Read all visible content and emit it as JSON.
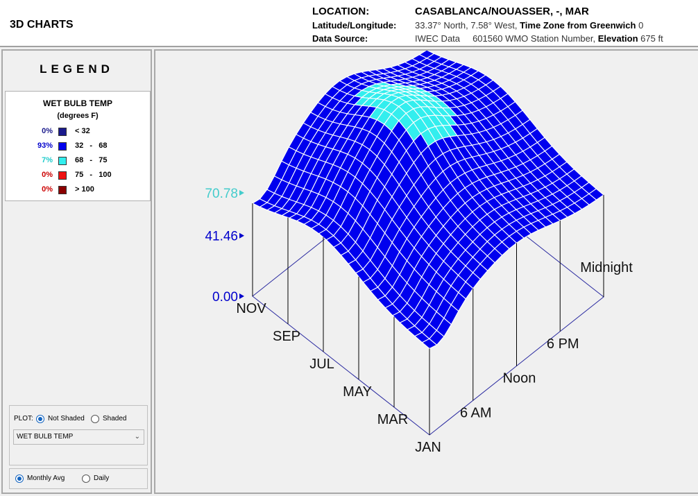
{
  "header": {
    "app_title": "3D CHARTS",
    "location_label": "LOCATION:",
    "location_value": "CASABLANCA/NOUASSER, -, MAR",
    "latlong_label": "Latitude/Longitude:",
    "latlong_value": "33.37° North, 7.58° West,",
    "tz_label": "Time Zone from Greenwich",
    "tz_value": "0",
    "source_label": "Data Source:",
    "source_value": "IWEC Data",
    "station_value": "601560 WMO Station Number,",
    "elevation_label": "Elevation",
    "elevation_value": "675 ft"
  },
  "legend": {
    "heading": "LEGEND",
    "title": "WET BULB TEMP",
    "units": "(degrees F)",
    "rows": [
      {
        "pct": "0%",
        "range": "< 32",
        "color": "#1a1a8c",
        "pct_color": "#1a1a8c"
      },
      {
        "pct": "93%",
        "range": "32   -   68",
        "color": "#0000ee",
        "pct_color": "#0000cc"
      },
      {
        "pct": "7%",
        "range": "68   -   75",
        "color": "#33eeee",
        "pct_color": "#22cccc"
      },
      {
        "pct": "0%",
        "range": "75   -   100",
        "color": "#ee1111",
        "pct_color": "#cc0000"
      },
      {
        "pct": "0%",
        "range": "> 100",
        "color": "#8b0000",
        "pct_color": "#cc0000"
      }
    ]
  },
  "controls": {
    "plot_label": "PLOT:",
    "not_shaded": "Not Shaded",
    "shaded": "Shaded",
    "selected_shading": "Not Shaded",
    "variable_select": "WET BULB TEMP",
    "monthly_avg": "Monthly Avg",
    "daily": "Daily",
    "selected_period": "Monthly Avg"
  },
  "chart": {
    "z_labels": [
      {
        "text": "70.78",
        "color": "#44cccc"
      },
      {
        "text": "41.46",
        "color": "#0000cc"
      },
      {
        "text": "0.00",
        "color": "#0000cc"
      }
    ],
    "month_labels": [
      "JAN",
      "MAR",
      "MAY",
      "JUL",
      "SEP",
      "NOV"
    ],
    "hour_labels": [
      "6 AM",
      "Noon",
      "6 PM",
      "Midnight"
    ],
    "surface_color": "#0000ee",
    "highlight_color": "#33eeee",
    "z_max_value": 70.78,
    "z_mid_value": 41.46
  }
}
